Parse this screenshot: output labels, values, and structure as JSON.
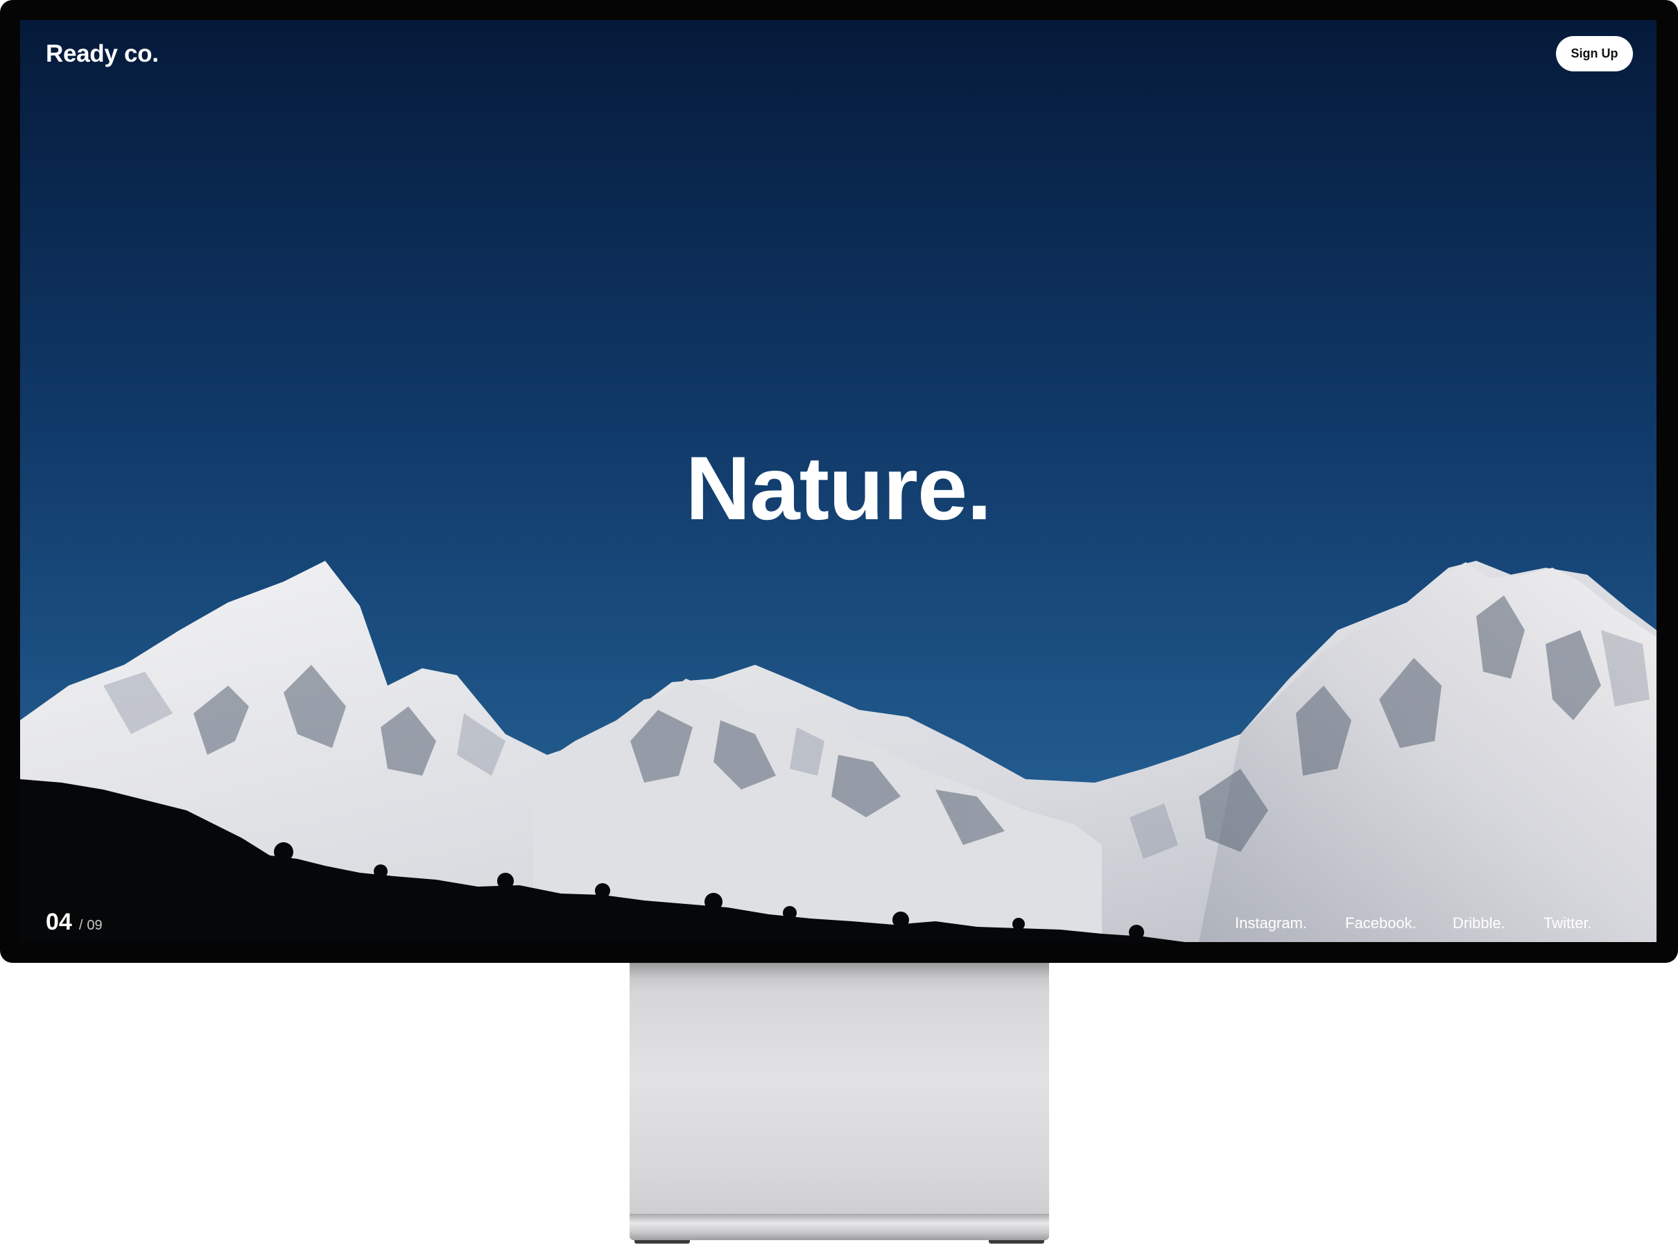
{
  "header": {
    "logo": "Ready co.",
    "signup_label": "Sign Up"
  },
  "hero": {
    "title": "Nature."
  },
  "pager": {
    "current": "04",
    "separator": "/",
    "total": "09"
  },
  "social_links": [
    {
      "label": "Instagram."
    },
    {
      "label": "Facebook."
    },
    {
      "label": "Dribble."
    },
    {
      "label": "Twitter."
    }
  ],
  "colors": {
    "sky_top": "#051a3a",
    "sky_bottom": "#1f5c90",
    "snow": "#e6e6ea",
    "rock": "#4a5666",
    "frame": "#050505",
    "stand": "#dcdcde"
  }
}
